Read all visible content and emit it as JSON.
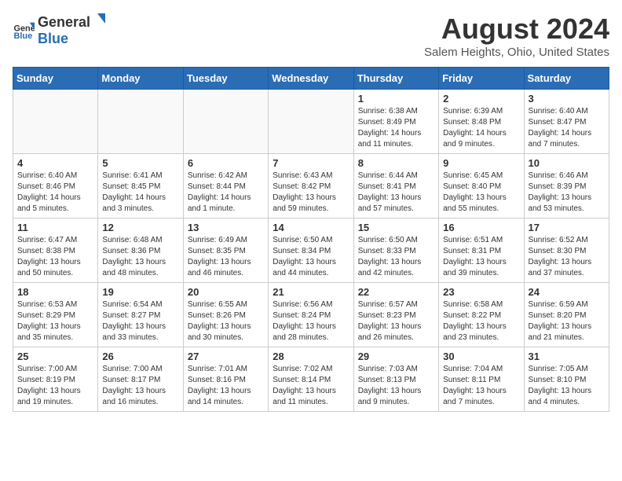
{
  "header": {
    "logo_general": "General",
    "logo_blue": "Blue",
    "title": "August 2024",
    "subtitle": "Salem Heights, Ohio, United States"
  },
  "days_of_week": [
    "Sunday",
    "Monday",
    "Tuesday",
    "Wednesday",
    "Thursday",
    "Friday",
    "Saturday"
  ],
  "weeks": [
    [
      {
        "day": "",
        "info": ""
      },
      {
        "day": "",
        "info": ""
      },
      {
        "day": "",
        "info": ""
      },
      {
        "day": "",
        "info": ""
      },
      {
        "day": "1",
        "info": "Sunrise: 6:38 AM\nSunset: 8:49 PM\nDaylight: 14 hours and 11 minutes."
      },
      {
        "day": "2",
        "info": "Sunrise: 6:39 AM\nSunset: 8:48 PM\nDaylight: 14 hours and 9 minutes."
      },
      {
        "day": "3",
        "info": "Sunrise: 6:40 AM\nSunset: 8:47 PM\nDaylight: 14 hours and 7 minutes."
      }
    ],
    [
      {
        "day": "4",
        "info": "Sunrise: 6:40 AM\nSunset: 8:46 PM\nDaylight: 14 hours and 5 minutes."
      },
      {
        "day": "5",
        "info": "Sunrise: 6:41 AM\nSunset: 8:45 PM\nDaylight: 14 hours and 3 minutes."
      },
      {
        "day": "6",
        "info": "Sunrise: 6:42 AM\nSunset: 8:44 PM\nDaylight: 14 hours and 1 minute."
      },
      {
        "day": "7",
        "info": "Sunrise: 6:43 AM\nSunset: 8:42 PM\nDaylight: 13 hours and 59 minutes."
      },
      {
        "day": "8",
        "info": "Sunrise: 6:44 AM\nSunset: 8:41 PM\nDaylight: 13 hours and 57 minutes."
      },
      {
        "day": "9",
        "info": "Sunrise: 6:45 AM\nSunset: 8:40 PM\nDaylight: 13 hours and 55 minutes."
      },
      {
        "day": "10",
        "info": "Sunrise: 6:46 AM\nSunset: 8:39 PM\nDaylight: 13 hours and 53 minutes."
      }
    ],
    [
      {
        "day": "11",
        "info": "Sunrise: 6:47 AM\nSunset: 8:38 PM\nDaylight: 13 hours and 50 minutes."
      },
      {
        "day": "12",
        "info": "Sunrise: 6:48 AM\nSunset: 8:36 PM\nDaylight: 13 hours and 48 minutes."
      },
      {
        "day": "13",
        "info": "Sunrise: 6:49 AM\nSunset: 8:35 PM\nDaylight: 13 hours and 46 minutes."
      },
      {
        "day": "14",
        "info": "Sunrise: 6:50 AM\nSunset: 8:34 PM\nDaylight: 13 hours and 44 minutes."
      },
      {
        "day": "15",
        "info": "Sunrise: 6:50 AM\nSunset: 8:33 PM\nDaylight: 13 hours and 42 minutes."
      },
      {
        "day": "16",
        "info": "Sunrise: 6:51 AM\nSunset: 8:31 PM\nDaylight: 13 hours and 39 minutes."
      },
      {
        "day": "17",
        "info": "Sunrise: 6:52 AM\nSunset: 8:30 PM\nDaylight: 13 hours and 37 minutes."
      }
    ],
    [
      {
        "day": "18",
        "info": "Sunrise: 6:53 AM\nSunset: 8:29 PM\nDaylight: 13 hours and 35 minutes."
      },
      {
        "day": "19",
        "info": "Sunrise: 6:54 AM\nSunset: 8:27 PM\nDaylight: 13 hours and 33 minutes."
      },
      {
        "day": "20",
        "info": "Sunrise: 6:55 AM\nSunset: 8:26 PM\nDaylight: 13 hours and 30 minutes."
      },
      {
        "day": "21",
        "info": "Sunrise: 6:56 AM\nSunset: 8:24 PM\nDaylight: 13 hours and 28 minutes."
      },
      {
        "day": "22",
        "info": "Sunrise: 6:57 AM\nSunset: 8:23 PM\nDaylight: 13 hours and 26 minutes."
      },
      {
        "day": "23",
        "info": "Sunrise: 6:58 AM\nSunset: 8:22 PM\nDaylight: 13 hours and 23 minutes."
      },
      {
        "day": "24",
        "info": "Sunrise: 6:59 AM\nSunset: 8:20 PM\nDaylight: 13 hours and 21 minutes."
      }
    ],
    [
      {
        "day": "25",
        "info": "Sunrise: 7:00 AM\nSunset: 8:19 PM\nDaylight: 13 hours and 19 minutes."
      },
      {
        "day": "26",
        "info": "Sunrise: 7:00 AM\nSunset: 8:17 PM\nDaylight: 13 hours and 16 minutes."
      },
      {
        "day": "27",
        "info": "Sunrise: 7:01 AM\nSunset: 8:16 PM\nDaylight: 13 hours and 14 minutes."
      },
      {
        "day": "28",
        "info": "Sunrise: 7:02 AM\nSunset: 8:14 PM\nDaylight: 13 hours and 11 minutes."
      },
      {
        "day": "29",
        "info": "Sunrise: 7:03 AM\nSunset: 8:13 PM\nDaylight: 13 hours and 9 minutes."
      },
      {
        "day": "30",
        "info": "Sunrise: 7:04 AM\nSunset: 8:11 PM\nDaylight: 13 hours and 7 minutes."
      },
      {
        "day": "31",
        "info": "Sunrise: 7:05 AM\nSunset: 8:10 PM\nDaylight: 13 hours and 4 minutes."
      }
    ]
  ]
}
